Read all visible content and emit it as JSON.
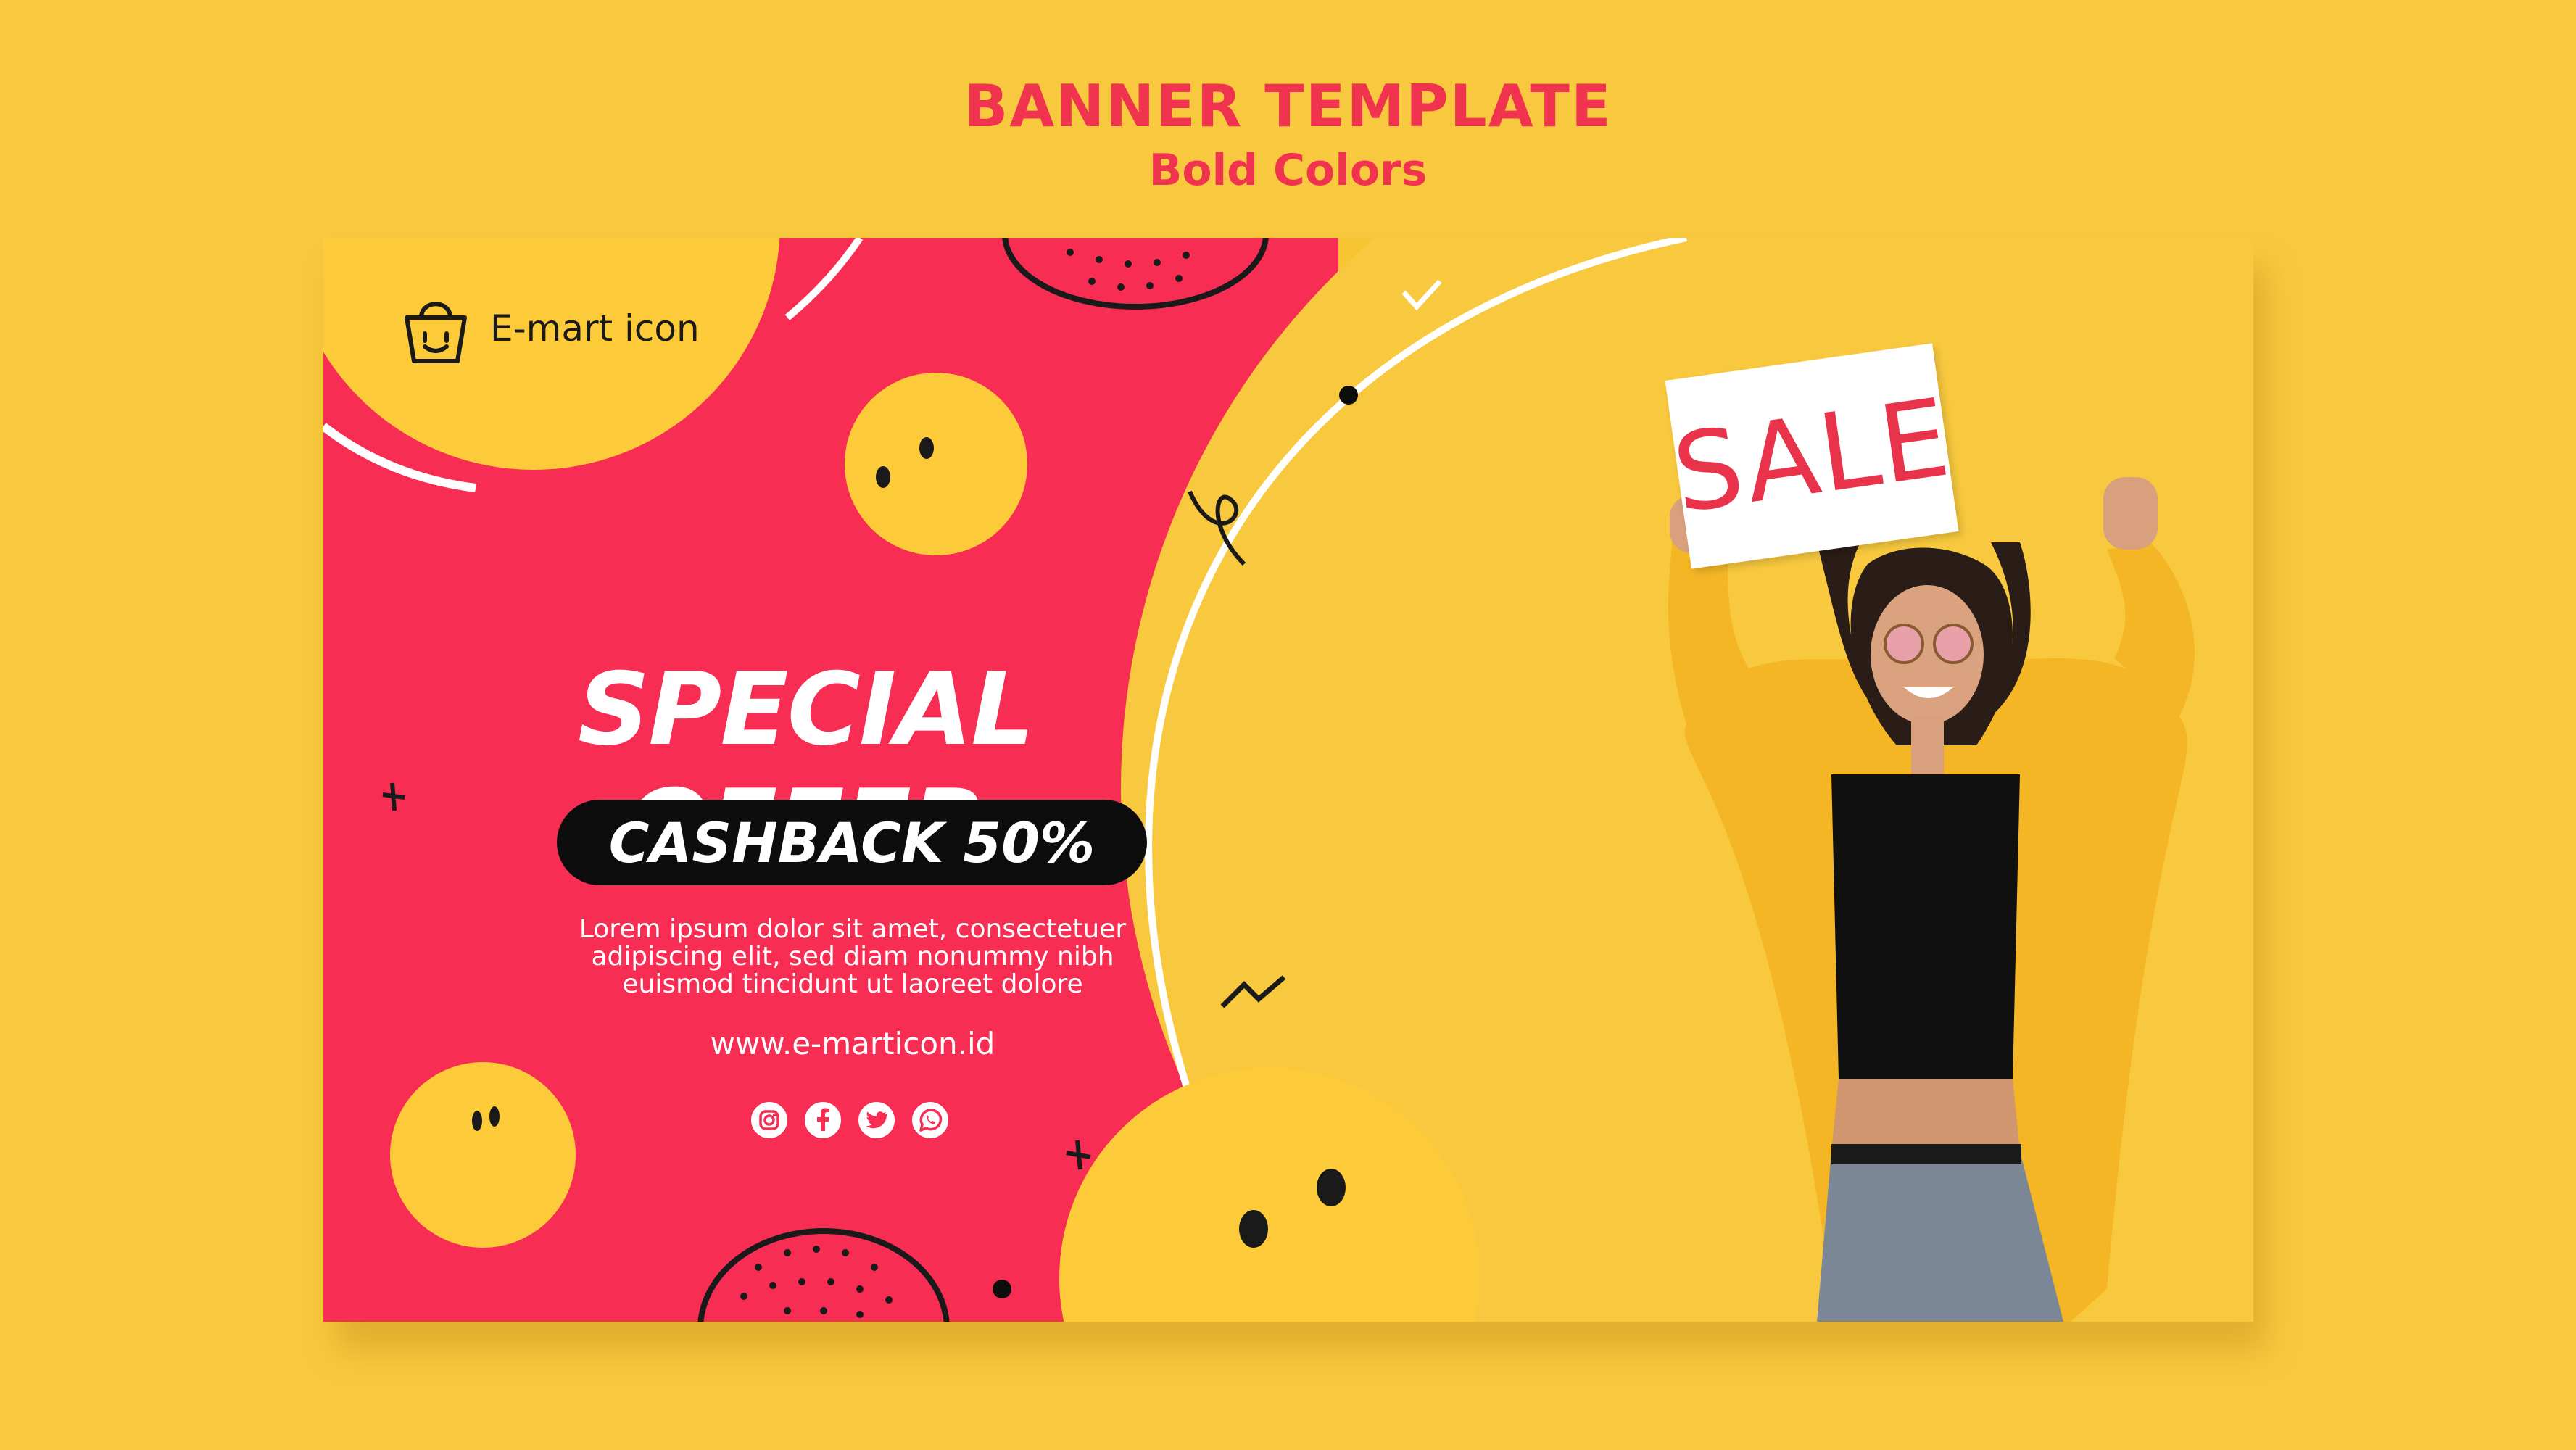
{
  "header": {
    "title": "BANNER TEMPLATE",
    "subtitle": "Bold Colors"
  },
  "banner": {
    "brand": {
      "name": "E-mart icon",
      "icon": "shopping-bag-smile-icon"
    },
    "headline": "SPECIAL OFFER",
    "cashback_label": "CASHBACK 50%",
    "body_lines": [
      "Lorem ipsum dolor sit amet, consectetuer",
      "adipiscing elit, sed diam nonummy nibh",
      "euismod tincidunt ut laoreet dolore"
    ],
    "website": "www.e-marticon.id",
    "social": [
      "instagram-icon",
      "facebook-icon",
      "twitter-icon",
      "whatsapp-icon"
    ],
    "photo": {
      "sign_text": "SALE"
    }
  },
  "colors": {
    "background": "#F8C93E",
    "accent_red": "#F72D53",
    "title_red": "#F0334E",
    "smiley_yellow": "#FDCB3A",
    "dark": "#0d0d0d",
    "white": "#ffffff"
  }
}
